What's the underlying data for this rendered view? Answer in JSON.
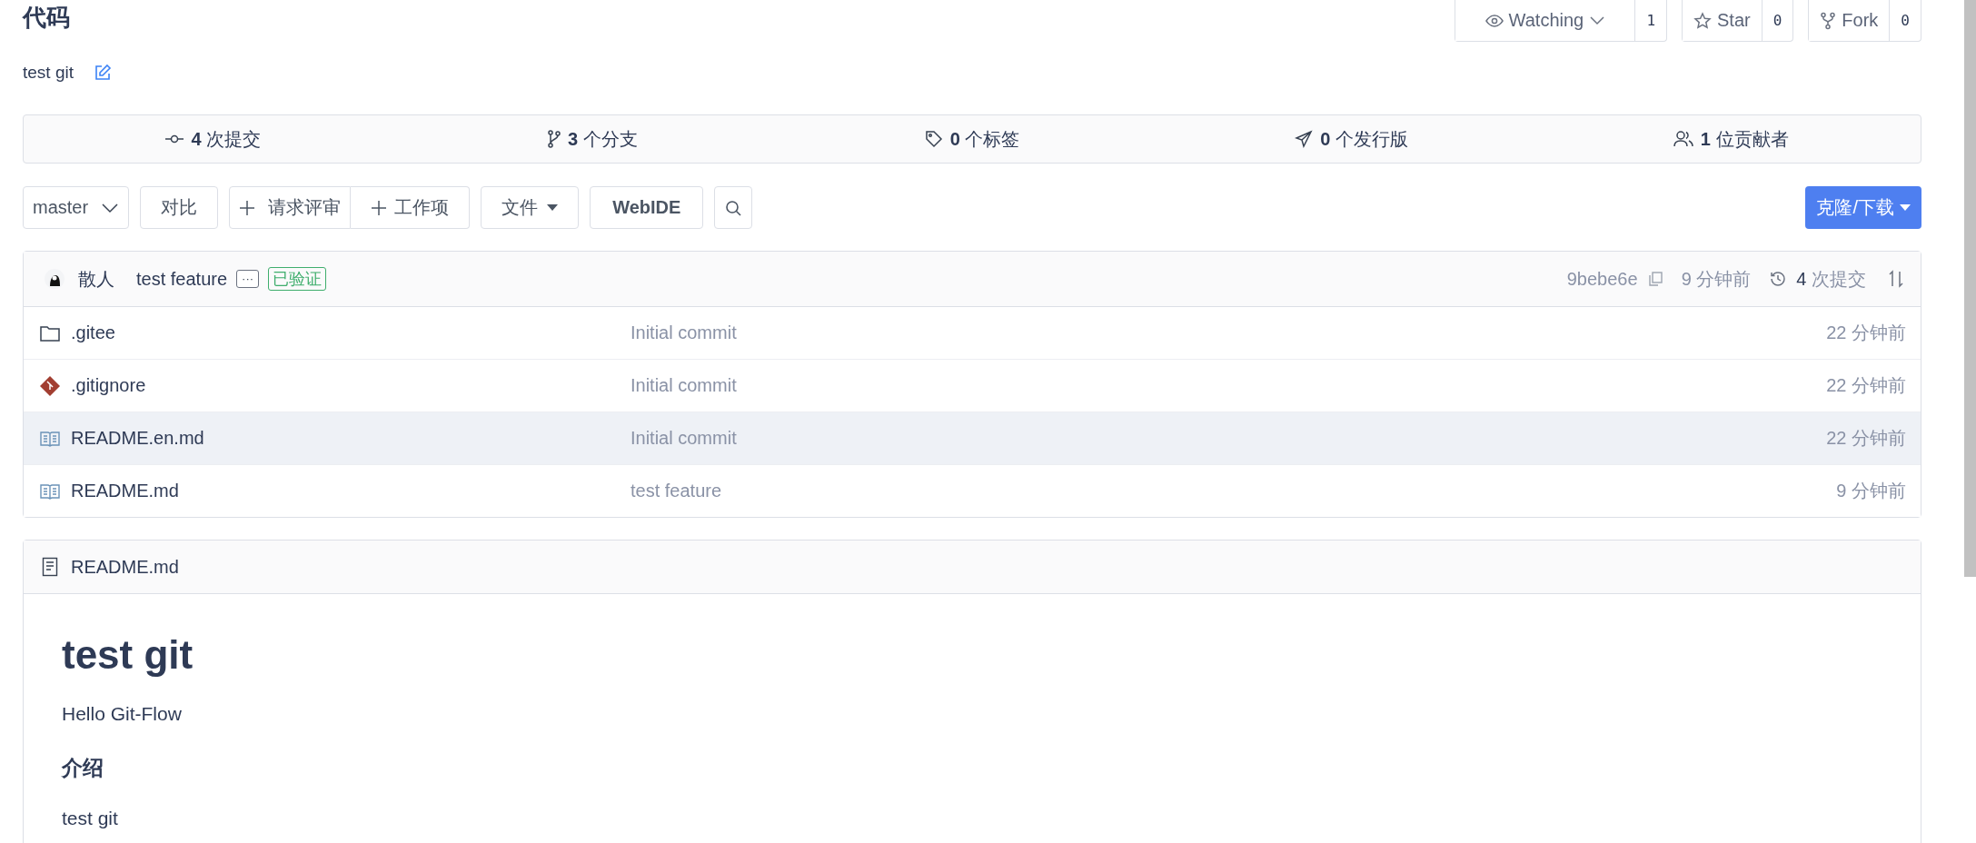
{
  "header": {
    "title": "代码",
    "description": "test git",
    "social": [
      {
        "kind": "watch",
        "label": "Watching",
        "count": "1"
      },
      {
        "kind": "star",
        "label": "Star",
        "count": "0"
      },
      {
        "kind": "fork",
        "label": "Fork",
        "count": "0"
      }
    ]
  },
  "stats": [
    {
      "kind": "commits",
      "text": "**4** 次提交"
    },
    {
      "kind": "branches",
      "text": "**3** 个分支"
    },
    {
      "kind": "tags",
      "text": "**0** 个标签"
    },
    {
      "kind": "releases",
      "text": "**0** 个发行版"
    },
    {
      "kind": "contributors",
      "text": "**1** 位贡献者"
    }
  ],
  "toolbar": {
    "branch": "master",
    "compare": "对比",
    "group": [
      "请求评审",
      "工作项"
    ],
    "file": "文件",
    "webide": "WebIDE",
    "clone": "克隆/下载"
  },
  "commit": {
    "author": "散人",
    "message": "test feature",
    "more": "···",
    "verified": "已验证",
    "hash": "9bebe6e",
    "time": "9 分钟前",
    "commits": "**4** 次提交"
  },
  "files": [
    {
      "kind": "folder",
      "name": ".gitee",
      "message": "Initial commit",
      "time": "22 分钟前",
      "highlighted": false
    },
    {
      "kind": "git",
      "name": ".gitignore",
      "message": "Initial commit",
      "time": "22 分钟前",
      "highlighted": false
    },
    {
      "kind": "readme",
      "name": "README.en.md",
      "message": "Initial commit",
      "time": "22 分钟前",
      "highlighted": true
    },
    {
      "kind": "readme",
      "name": "README.md",
      "message": "test feature",
      "time": "9 分钟前",
      "highlighted": false
    }
  ],
  "readme": {
    "filename": "README.md",
    "blocks": [
      {
        "kind": "h1",
        "text": "test git"
      },
      {
        "kind": "p",
        "text": "Hello Git-Flow"
      },
      {
        "kind": "h3",
        "text": "介绍"
      },
      {
        "kind": "p",
        "text": "test git"
      }
    ]
  }
}
